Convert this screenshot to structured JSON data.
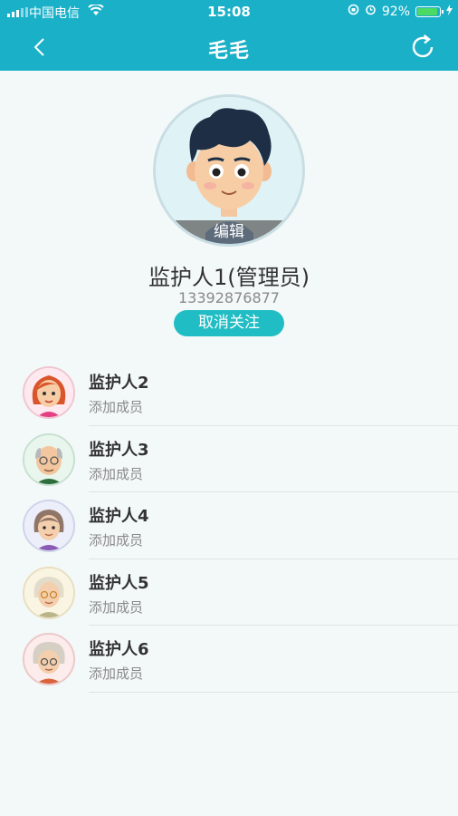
{
  "status_bar": {
    "carrier": "中国电信",
    "time": "15:08",
    "battery": "92%",
    "battery_level": 0.92
  },
  "nav": {
    "title": "毛毛"
  },
  "main_member": {
    "edit_label": "编辑",
    "name": "监护人1(管理员)",
    "phone": "13392876877",
    "unfollow_label": "取消关注"
  },
  "members": [
    {
      "name": "监护人2",
      "sub": "添加成员",
      "avatar": "girl-avatar"
    },
    {
      "name": "监护人3",
      "sub": "添加成员",
      "avatar": "grandpa-avatar"
    },
    {
      "name": "监护人4",
      "sub": "添加成员",
      "avatar": "woman-avatar"
    },
    {
      "name": "监护人5",
      "sub": "添加成员",
      "avatar": "grandma-avatar"
    },
    {
      "name": "监护人6",
      "sub": "添加成员",
      "avatar": "elderly-woman-avatar"
    }
  ],
  "colors": {
    "accent": "#1ab0c8",
    "button": "#21bdc4",
    "background": "#f3f8f8"
  }
}
